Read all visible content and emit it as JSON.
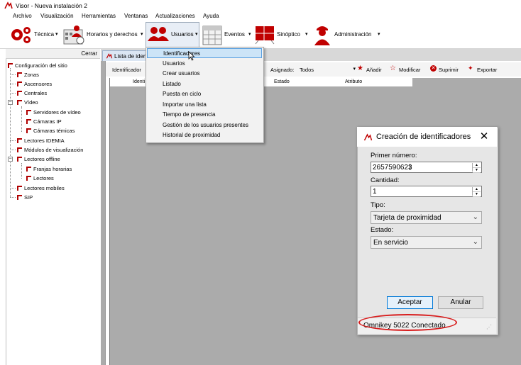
{
  "window": {
    "title": "Visor - Nueva instalación 2"
  },
  "menu": [
    "Archivo",
    "Visualización",
    "Herramientas",
    "Ventanas",
    "Actualizaciones",
    "Ayuda"
  ],
  "toolbar": {
    "tecnica": "Técnica",
    "horarios": "Horarios y derechos",
    "usuarios": "Usuarios",
    "eventos": "Eventos",
    "sinoptico": "Sinóptico",
    "administracion": "Administración"
  },
  "left_panel": {
    "close_label": "Cerrar",
    "tree": [
      "Configuración del sitio",
      "Zonas",
      "Ascensores",
      "Centrales",
      "Vídeo",
      "Servidores de vídeo",
      "Cámaras IP",
      "Cámaras témicas",
      "Lectores IDEMIA",
      "Módulos de visualización",
      "Lectores offline",
      "Franjas horarias",
      "Lectores",
      "Lectores mobiles",
      "SIP"
    ]
  },
  "tab": {
    "label": "Lista de iden"
  },
  "filter": {
    "identificador_label": "Identificador",
    "asignado_label": "Asignado:",
    "asignado_value": "Todos",
    "anadir": "Añadir",
    "modificar": "Modificar",
    "suprimir": "Suprimir",
    "exportar": "Exportar"
  },
  "grid_columns": [
    "Identi",
    "Estado",
    "Atributo"
  ],
  "usuarios_menu": [
    "Identificadores",
    "Usuarios",
    "Crear usuarios",
    "Listado",
    "Puesta en ciclo",
    "Importar una lista",
    "Tiempo de presencia",
    "Gestión de los usuarios presentes",
    "Historial de proximidad"
  ],
  "dialog": {
    "title": "Creación de identificadores",
    "primer_numero_label": "Primer número:",
    "primer_numero_value": "2657590623",
    "cantidad_label": "Cantidad:",
    "cantidad_value": "1",
    "tipo_label": "Tipo:",
    "tipo_value": "Tarjeta de proximidad",
    "estado_label": "Estado:",
    "estado_value": "En servicio",
    "aceptar": "Aceptar",
    "anular": "Anular",
    "status": "Omnikey 5022 Conectado"
  }
}
